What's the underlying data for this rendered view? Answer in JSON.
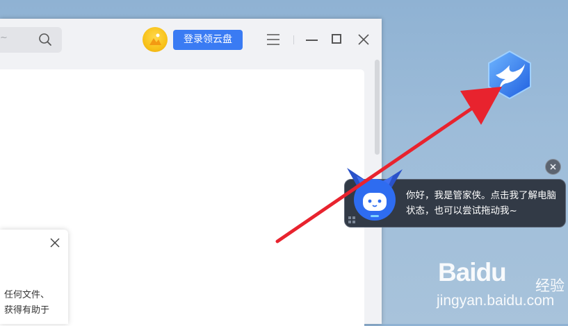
{
  "window": {
    "search": {
      "placeholder": "~"
    },
    "login_button": "登录领云盘"
  },
  "popup": {
    "line1": "任何文件、",
    "line2": "获得有助于"
  },
  "butler": {
    "bubble_text": "你好，我是管家侠。点击我了解电脑状态，也可以尝试拖动我~"
  },
  "watermark": {
    "brand": "Baidu",
    "cn": "经验",
    "url": "jingyan.baidu.com"
  },
  "colors": {
    "accent": "#3a7bf3",
    "arrow": "#e8232e",
    "bubble_bg": "#323a46"
  }
}
